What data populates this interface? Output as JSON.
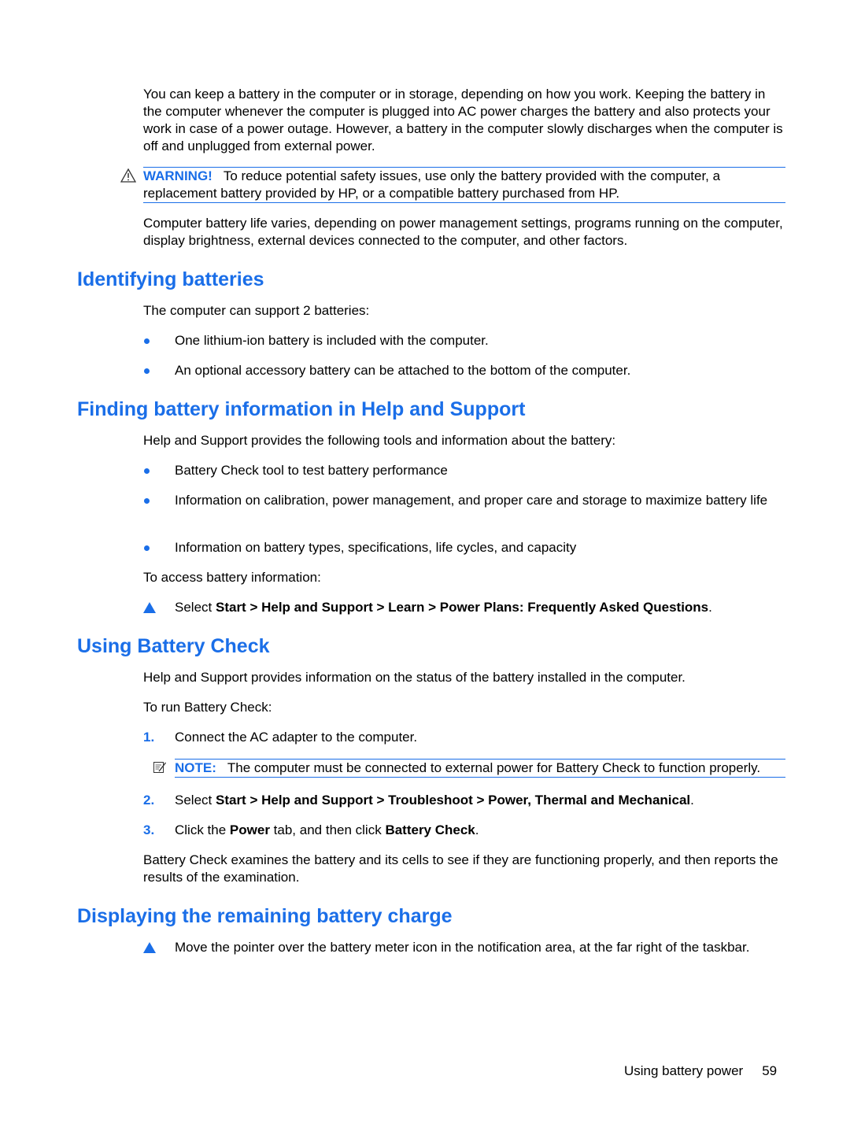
{
  "intro_paragraph": "You can keep a battery in the computer or in storage, depending on how you work. Keeping the battery in the computer whenever the computer is plugged into AC power charges the battery and also protects your work in case of a power outage. However, a battery in the computer slowly discharges when the computer is off and unplugged from external power.",
  "warning": {
    "icon": "warning-triangle-icon",
    "label": "WARNING!",
    "text": "To reduce potential safety issues, use only the battery provided with the computer, a replacement battery provided by HP, or a compatible battery purchased from HP."
  },
  "life_paragraph": "Computer battery life varies, depending on power management settings, programs running on the computer, display brightness, external devices connected to the computer, and other factors.",
  "sections": {
    "identifying": {
      "heading": "Identifying batteries",
      "intro": "The computer can support 2 batteries:",
      "bullets": [
        "One lithium-ion battery is included with the computer.",
        "An optional accessory battery can be attached to the bottom of the computer."
      ]
    },
    "finding": {
      "heading": "Finding battery information in Help and Support",
      "intro": "Help and Support provides the following tools and information about the battery:",
      "bullets": [
        "Battery Check tool to test battery performance",
        "Information on calibration, power management, and proper care and storage to maximize battery life",
        "Information on battery types, specifications, life cycles, and capacity"
      ],
      "access_intro": "To access battery information:",
      "step": {
        "prefix": "Select ",
        "path": "Start > Help and Support > Learn > Power Plans: Frequently Asked Questions",
        "suffix": "."
      }
    },
    "battery_check": {
      "heading": "Using Battery Check",
      "intro": "Help and Support provides information on the status of the battery installed in the computer.",
      "run_intro": "To run Battery Check:",
      "steps": [
        {
          "num": "1.",
          "text": "Connect the AC adapter to the computer."
        },
        {
          "num": "2.",
          "prefix": "Select ",
          "bold": "Start > Help and Support > Troubleshoot > Power, Thermal and Mechanical",
          "suffix": "."
        },
        {
          "num": "3.",
          "prefix": "Click the ",
          "bold1": "Power",
          "mid": " tab, and then click ",
          "bold2": "Battery Check",
          "suffix": "."
        }
      ],
      "note": {
        "icon": "note-icon",
        "label": "NOTE:",
        "text": "The computer must be connected to external power for Battery Check to function properly."
      },
      "outro": "Battery Check examines the battery and its cells to see if they are functioning properly, and then reports the results of the examination."
    },
    "remaining": {
      "heading": "Displaying the remaining battery charge",
      "step": "Move the pointer over the battery meter icon in the notification area, at the far right of the taskbar."
    }
  },
  "footer": {
    "section": "Using battery power",
    "page_number": "59"
  }
}
